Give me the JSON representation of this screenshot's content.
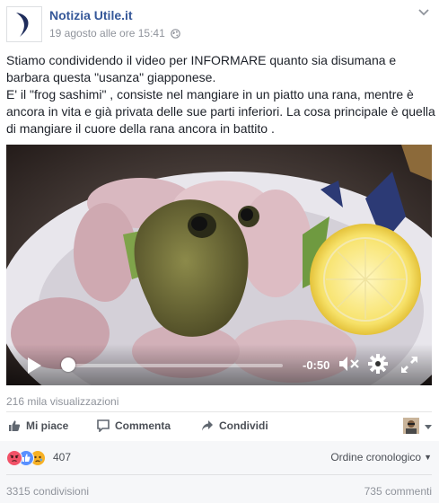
{
  "post": {
    "page_name": "Notizia Utile.it",
    "timestamp": "19 agosto alle ore 15:41",
    "visibility_icon": "globe-icon",
    "options_icon": "chevron-down-icon",
    "text_lines": [
      "Stiamo condividendo il video per INFORMARE quanto sia disumana e barbara questa \"usanza\" giapponese.",
      "E' il \"frog sashimi\" , consiste nel mangiare in un piatto una rana, mentre è ancora in vita e già privata delle sue parti inferiori. La cosa principale è quella di mangiare il cuore della rana ancora in battito ."
    ]
  },
  "video": {
    "time_remaining": "-0:50",
    "progress": 0.03,
    "play_icon": "play-icon",
    "mute_icon": "muted-speaker-icon",
    "settings_icon": "gear-icon",
    "fullscreen_icon": "fullscreen-icon"
  },
  "views": "216 mila visualizzazioni",
  "actions": {
    "like_label": "Mi piace",
    "comment_label": "Commenta",
    "share_label": "Condividi"
  },
  "reactions": {
    "types": [
      "angry",
      "like",
      "sad"
    ],
    "count": "407",
    "order_label": "Ordine cronologico"
  },
  "stats": {
    "shares": "3315 condivisioni",
    "comments": "735 commenti"
  },
  "colors": {
    "link": "#365899",
    "like_blue": "#5890ff",
    "angry": "#f25268",
    "sad": "#f7b125"
  }
}
